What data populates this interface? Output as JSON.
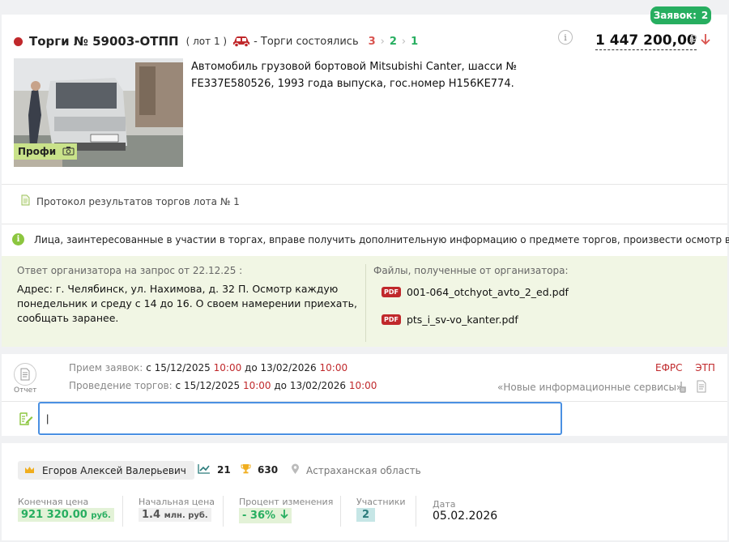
{
  "header": {
    "bids_label": "Заявок:",
    "bids_count": "2",
    "title": "Торги № 59003-ОТПП",
    "lot": "( лот 1 )",
    "status": "- Торги состоялись",
    "steps": [
      "3",
      "2",
      "1"
    ],
    "price": "1 447 200,00",
    "currency": "₽"
  },
  "lot": {
    "description": "Автомобиль грузовой бортовой Mitsubishi Canter, шасси № FE337E580526, 1993 года выпуска, гос.номер Н156КЕ774.",
    "photo_badge": "Профи"
  },
  "protocol": {
    "label": "Протокол результатов торгов лота № 1"
  },
  "notice": {
    "text": "Лица, заинтересованные в участии в торгах, вправе получить дополнительную информацию о предмете торгов, произвести осмотр в …"
  },
  "answer": {
    "heading": "Ответ организатора на запрос от 22.12.25 :",
    "text": "Адрес: г. Челябинск, ул. Нахимова, д. 32 П. Осмотр каждую понедельник и среду с 14 до 16. О своем намерении приехать, сообщать заранее.",
    "files_heading": "Файлы, полученные от организатора:",
    "files": [
      {
        "badge": "PDF",
        "name": "001-064_otchyot_avto_2_ed.pdf"
      },
      {
        "badge": "PDF",
        "name": "pts_i_sv-vo_kanter.pdf"
      }
    ]
  },
  "schedule": {
    "report_label": "Отчет",
    "applications": {
      "label": "Прием заявок:",
      "from_word": "с",
      "from_date": "15/12/2025",
      "from_time": "10:00",
      "to_word": "до",
      "to_date": "13/02/2026",
      "to_time": "10:00"
    },
    "auction": {
      "label": "Проведение торгов:",
      "from_word": "с",
      "from_date": "15/12/2025",
      "from_time": "10:00",
      "to_word": "до",
      "to_date": "13/02/2026",
      "to_time": "10:00"
    },
    "efrs_label": "ЕФРС",
    "etp_label": "ЭТП",
    "etp_name": "«Новые информационные сервисы»"
  },
  "comment_input": {
    "value": "|"
  },
  "winner": {
    "name": "Егоров Алексей Валерьевич",
    "trades_count": "21",
    "wins_count": "630",
    "region": "Астраханская область"
  },
  "metrics": {
    "final_price": {
      "label": "Конечная цена",
      "value": "921 320.00",
      "unit": "руб."
    },
    "start_price": {
      "label": "Начальная цена",
      "value": "1.4",
      "unit": "млн. руб."
    },
    "change": {
      "label": "Процент изменения",
      "value": "- 36%"
    },
    "participants": {
      "label": "Участники",
      "value": "2"
    },
    "date": {
      "label": "Дата",
      "value": "05.02.2026"
    }
  },
  "colors": {
    "accent_red": "#c0282b",
    "accent_green": "#27ae60",
    "input_focus": "#4a90e2",
    "answer_bg": "#f1f6e4"
  }
}
